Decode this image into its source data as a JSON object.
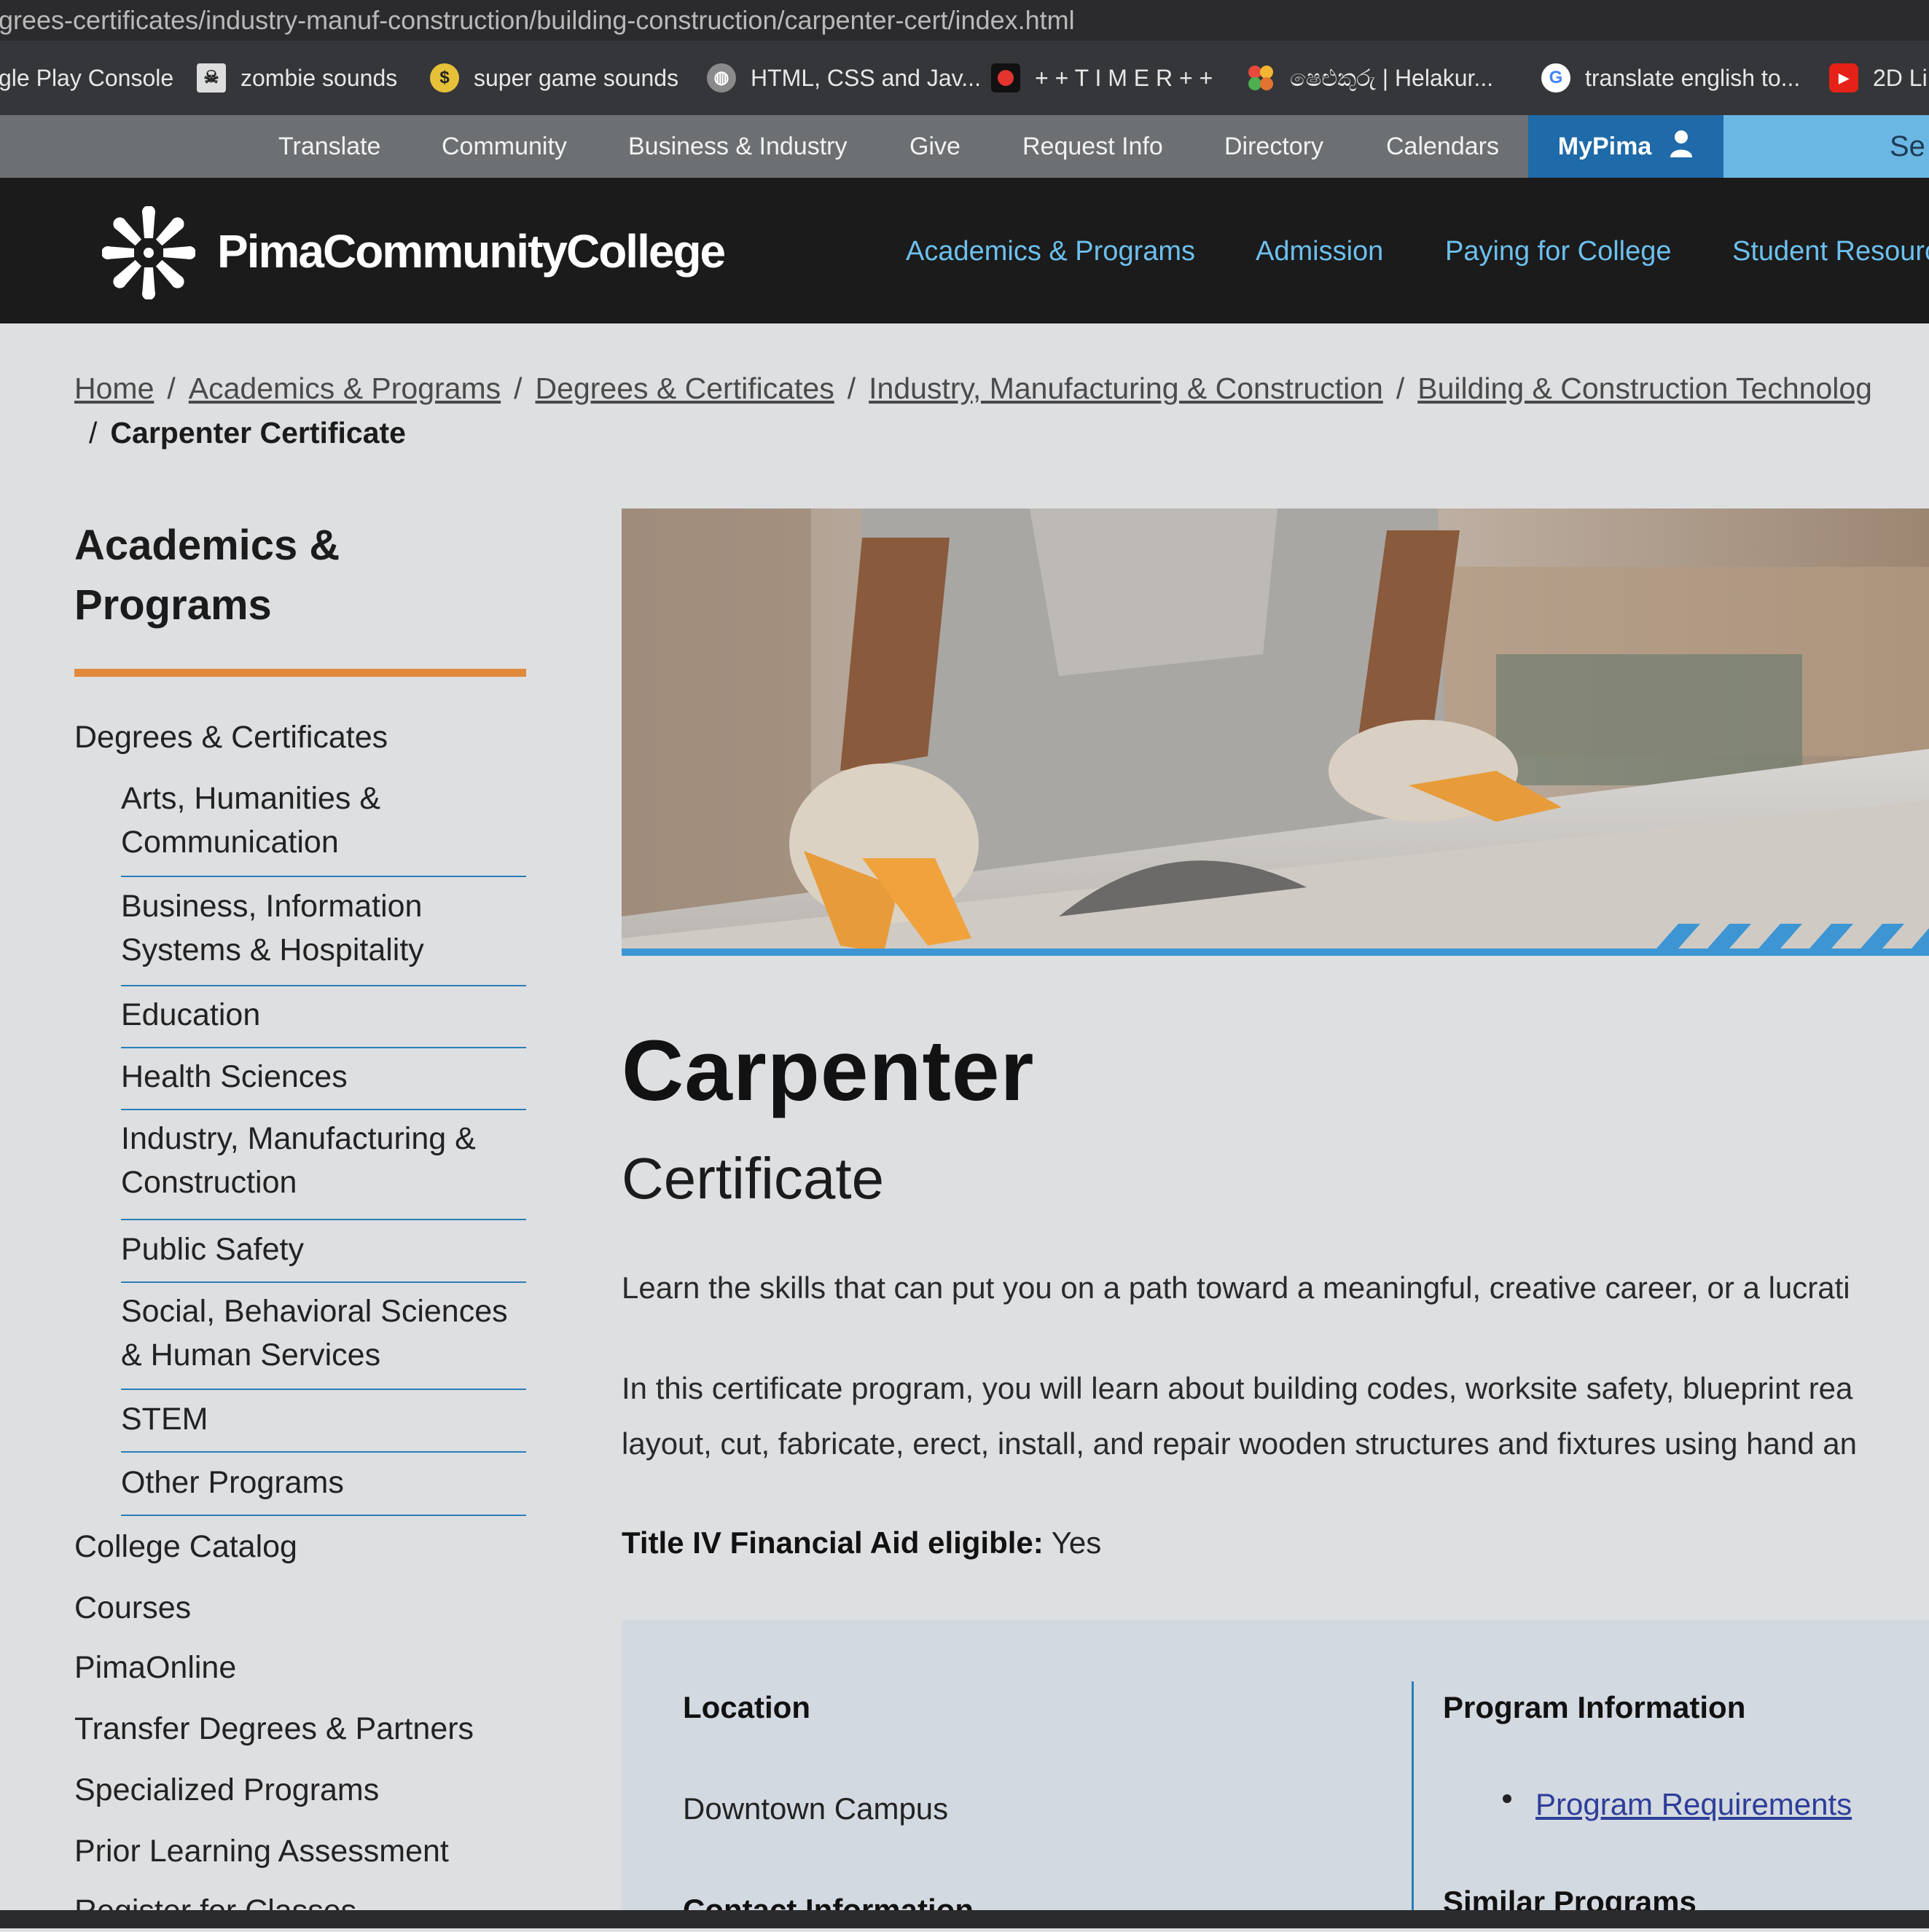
{
  "browser": {
    "url": "grees-certificates/industry-manuf-construction/building-construction/carpenter-cert/index.html",
    "bookmarks": [
      {
        "label": "gle Play Console",
        "icon": "none"
      },
      {
        "label": "zombie sounds",
        "icon": "zombie-icon"
      },
      {
        "label": "super game sounds",
        "icon": "coin-icon"
      },
      {
        "label": "HTML, CSS and Jav...",
        "icon": "globe-icon"
      },
      {
        "label": "+ + T I M E R + +",
        "icon": "timer-icon"
      },
      {
        "label": "ෂෙළුකුරු | Helakur...",
        "icon": "flower-icon"
      },
      {
        "label": "translate english to...",
        "icon": "google-icon"
      },
      {
        "label": "2D Li",
        "icon": "youtube-icon"
      }
    ]
  },
  "utility_nav": {
    "items": [
      "Translate",
      "Community",
      "Business & Industry",
      "Give",
      "Request Info",
      "Directory",
      "Calendars"
    ],
    "mypima": "MyPima",
    "search_partial": "Se"
  },
  "header": {
    "logo_text": "PimaCommunityCollege",
    "nav": [
      "Academics & Programs",
      "Admission",
      "Paying for College",
      "Student Resourc"
    ]
  },
  "breadcrumb": {
    "links": [
      "Home",
      "Academics & Programs",
      "Degrees & Certificates",
      "Industry, Manufacturing & Construction",
      "Building & Construction Technolog"
    ],
    "current": "Carpenter Certificate"
  },
  "sidebar": {
    "title_line1": "Academics &",
    "title_line2": "Programs",
    "section": "Degrees & Certificates",
    "sub_items": [
      [
        "Arts, Humanities &",
        "Communication"
      ],
      [
        "Business, Information",
        "Systems & Hospitality"
      ],
      [
        "Education"
      ],
      [
        "Health Sciences"
      ],
      [
        "Industry, Manufacturing &",
        "Construction"
      ],
      [
        "Public Safety"
      ],
      [
        "Social, Behavioral Sciences",
        "& Human Services"
      ],
      [
        "STEM"
      ],
      [
        "Other Programs"
      ]
    ],
    "links": [
      "College Catalog",
      "Courses",
      "PimaOnline",
      "Transfer Degrees & Partners",
      "Specialized Programs",
      "Prior Learning Assessment",
      "Register for Classes"
    ]
  },
  "main": {
    "title": "Carpenter",
    "subtitle": "Certificate",
    "intro": "Learn the skills that can put you on a path toward a meaningful, creative career, or a lucrati",
    "body_line1": "In this certificate program, you will learn about building codes, worksite safety, blueprint rea",
    "body_line2": "layout, cut, fabricate, erect, install, and repair wooden structures and fixtures using hand an",
    "aid_label": "Title IV Financial Aid eligible:",
    "aid_value": "Yes"
  },
  "info": {
    "location_label": "Location",
    "location_value": "Downtown Campus",
    "contact_label": "Contact Information",
    "program_info_label": "Program Information",
    "program_requirements": "Program Requirements",
    "similar_programs": "Similar Programs"
  },
  "colors": {
    "accent_orange": "#e18a3c",
    "link_blue": "#6cc0ee",
    "mypima_blue": "#1f6aa8",
    "header_dark": "#1b1b1b",
    "rule_blue": "#2a7fb8"
  }
}
